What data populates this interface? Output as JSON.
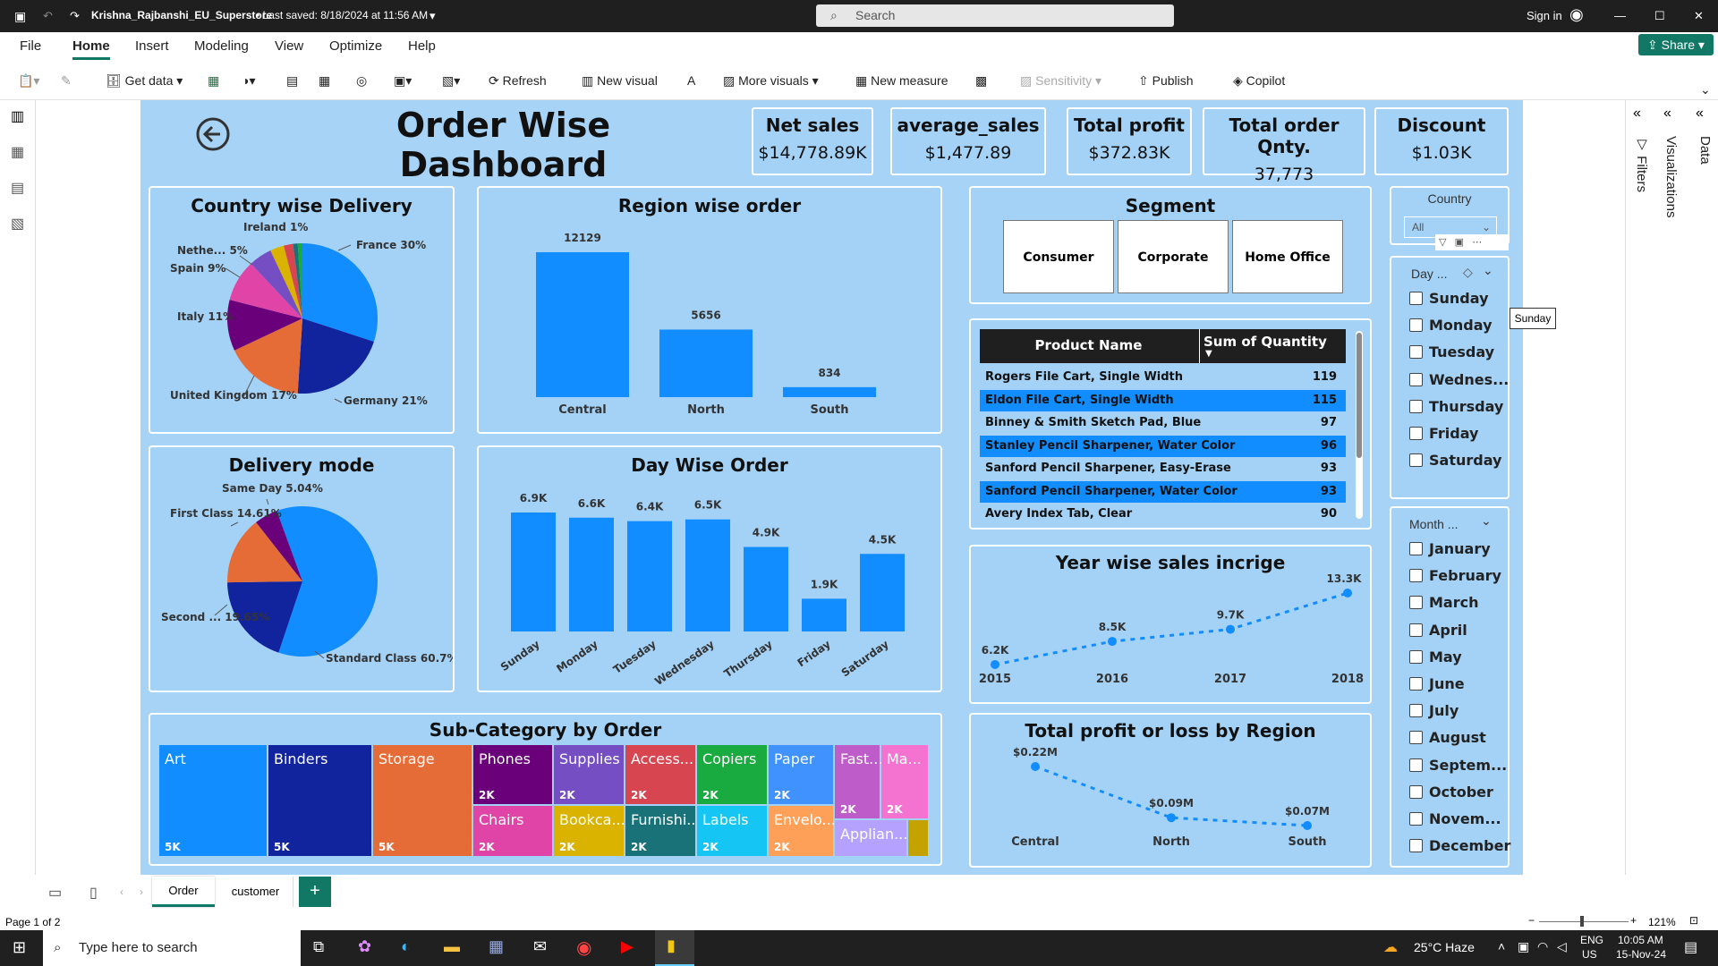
{
  "window": {
    "title": "Krishna_Rajbanshi_EU_Superstore",
    "saved": "• Last saved: 8/18/2024 at 11:56 AM",
    "search_placeholder": "Search",
    "signin": "Sign in",
    "share": "Share"
  },
  "menu": [
    "File",
    "Home",
    "Insert",
    "Modeling",
    "View",
    "Optimize",
    "Help"
  ],
  "ribbon": {
    "get_data": "Get data",
    "refresh": "Refresh",
    "new_visual": "New visual",
    "more_visuals": "More visuals",
    "new_measure": "New measure",
    "sensitivity": "Sensitivity",
    "publish": "Publish",
    "copilot": "Copilot"
  },
  "dashboard": {
    "title": "Order Wise Dashboard"
  },
  "kpis": [
    {
      "label": "Net sales",
      "value": "$14,778.89K"
    },
    {
      "label": "average_sales",
      "value": "$1,477.89"
    },
    {
      "label": "Total profit",
      "value": "$372.83K"
    },
    {
      "label": "Total order Qnty.",
      "value": "37,773"
    },
    {
      "label": "Discount",
      "value": "$1.03K"
    }
  ],
  "country_pie": {
    "title": "Country wise Delivery",
    "slices": [
      {
        "label": "France 30%",
        "pct": 30,
        "color": "#118dff"
      },
      {
        "label": "Germany 21%",
        "pct": 21,
        "color": "#12239e"
      },
      {
        "label": "United Kingdom 17%",
        "pct": 17,
        "color": "#e66c37"
      },
      {
        "label": "Italy 11%",
        "pct": 11,
        "color": "#6b007b"
      },
      {
        "label": "Spain 9%",
        "pct": 9,
        "color": "#e044a7"
      },
      {
        "label": "Nethe... 5%",
        "pct": 5,
        "color": "#744ec2"
      },
      {
        "label": "",
        "pct": 3,
        "color": "#d9b300"
      },
      {
        "label": "",
        "pct": 2,
        "color": "#d64550"
      },
      {
        "label": "Ireland 1%",
        "pct": 1,
        "color": "#197278"
      },
      {
        "label": "",
        "pct": 1,
        "color": "#1aab40"
      }
    ]
  },
  "region_bar": {
    "title": "Region wise order",
    "categories": [
      "Central",
      "North",
      "South"
    ],
    "values": [
      12129,
      5656,
      834
    ],
    "labels": [
      "12129",
      "5656",
      "834"
    ]
  },
  "segment": {
    "title": "Segment",
    "items": [
      "Consumer",
      "Corporate",
      "Home Office"
    ]
  },
  "country_slicer": {
    "title": "Country",
    "value": "All"
  },
  "day_slicer": {
    "title": "Day ...",
    "items": [
      "Sunday",
      "Monday",
      "Tuesday",
      "Wednes...",
      "Thursday",
      "Friday",
      "Saturday"
    ],
    "tooltip": "Sunday"
  },
  "month_slicer": {
    "title": "Month ...",
    "items": [
      "January",
      "February",
      "March",
      "April",
      "May",
      "June",
      "July",
      "August",
      "Septem...",
      "October",
      "Novem...",
      "December"
    ]
  },
  "product_table": {
    "headers": [
      "Product Name",
      "Sum of Quantity"
    ],
    "rows": [
      [
        "Rogers File Cart, Single Width",
        "119"
      ],
      [
        "Eldon File Cart, Single Width",
        "115"
      ],
      [
        "Binney & Smith Sketch Pad, Blue",
        "97"
      ],
      [
        "Stanley Pencil Sharpener, Water Color",
        "96"
      ],
      [
        "Sanford Pencil Sharpener, Easy-Erase",
        "93"
      ],
      [
        "Sanford Pencil Sharpener, Water Color",
        "93"
      ],
      [
        "Avery Index Tab, Clear",
        "90"
      ]
    ]
  },
  "delivery_pie": {
    "title": "Delivery mode",
    "slices": [
      {
        "label": "Standard Class 60.7%",
        "pct": 60.7,
        "color": "#118dff"
      },
      {
        "label": "Second ... 19.65%",
        "pct": 19.65,
        "color": "#12239e"
      },
      {
        "label": "First Class 14.61%",
        "pct": 14.61,
        "color": "#e66c37"
      },
      {
        "label": "Same Day 5.04%",
        "pct": 5.04,
        "color": "#6b007b"
      }
    ]
  },
  "day_bar": {
    "title": "Day Wise Order",
    "categories": [
      "Sunday",
      "Monday",
      "Tuesday",
      "Wednesday",
      "Thursday",
      "Friday",
      "Saturday"
    ],
    "values": [
      6900,
      6600,
      6400,
      6500,
      4900,
      1900,
      4500
    ],
    "labels": [
      "6.9K",
      "6.6K",
      "6.4K",
      "6.5K",
      "4.9K",
      "1.9K",
      "4.5K"
    ]
  },
  "year_line": {
    "title": "Year wise sales incrige",
    "x": [
      "2015",
      "2016",
      "2017",
      "2018"
    ],
    "values": [
      6.2,
      8.5,
      9.7,
      13.3
    ],
    "labels": [
      "6.2K",
      "8.5K",
      "9.7K",
      "13.3K"
    ]
  },
  "profit_line": {
    "title": "Total profit or loss by Region",
    "x": [
      "Central",
      "North",
      "South"
    ],
    "values": [
      0.22,
      0.09,
      0.07
    ],
    "labels": [
      "$0.22M",
      "$0.09M",
      "$0.07M"
    ]
  },
  "treemap": {
    "title": "Sub-Category by Order",
    "tiles": [
      {
        "name": "Art",
        "value": "5K",
        "color": "#118dff"
      },
      {
        "name": "Binders",
        "value": "5K",
        "color": "#12239e"
      },
      {
        "name": "Storage",
        "value": "5K",
        "color": "#e66c37"
      },
      {
        "name": "Phones",
        "value": "2K",
        "color": "#6b007b"
      },
      {
        "name": "Chairs",
        "value": "2K",
        "color": "#e044a7"
      },
      {
        "name": "Supplies",
        "value": "2K",
        "color": "#744ec2"
      },
      {
        "name": "Bookca...",
        "value": "2K",
        "color": "#d9b300"
      },
      {
        "name": "Access...",
        "value": "2K",
        "color": "#d64550"
      },
      {
        "name": "Furnishi...",
        "value": "2K",
        "color": "#197278"
      },
      {
        "name": "Copiers",
        "value": "2K",
        "color": "#1aab40"
      },
      {
        "name": "Labels",
        "value": "2K",
        "color": "#15c6f4"
      },
      {
        "name": "Paper",
        "value": "2K",
        "color": "#4092ff"
      },
      {
        "name": "Envelo...",
        "value": "2K",
        "color": "#ffa058"
      },
      {
        "name": "Fast...",
        "value": "2K",
        "color": "#be5dc9"
      },
      {
        "name": "Ma...",
        "value": "2K",
        "color": "#f472d0"
      },
      {
        "name": "Applian...",
        "value": "",
        "color": "#b5a1ff"
      },
      {
        "name": "",
        "value": "",
        "color": "#c4a200"
      }
    ]
  },
  "page_tabs": [
    "Order",
    "customer"
  ],
  "status": {
    "page": "Page 1 of 2",
    "zoom": "121%"
  },
  "right_panes": [
    "Filters",
    "Visualizations",
    "Data"
  ],
  "taskbar": {
    "search": "Type here to search",
    "weather": "25°C  Haze",
    "lang1": "ENG",
    "lang2": "US",
    "time": "10:05 AM",
    "date": "15-Nov-24"
  }
}
